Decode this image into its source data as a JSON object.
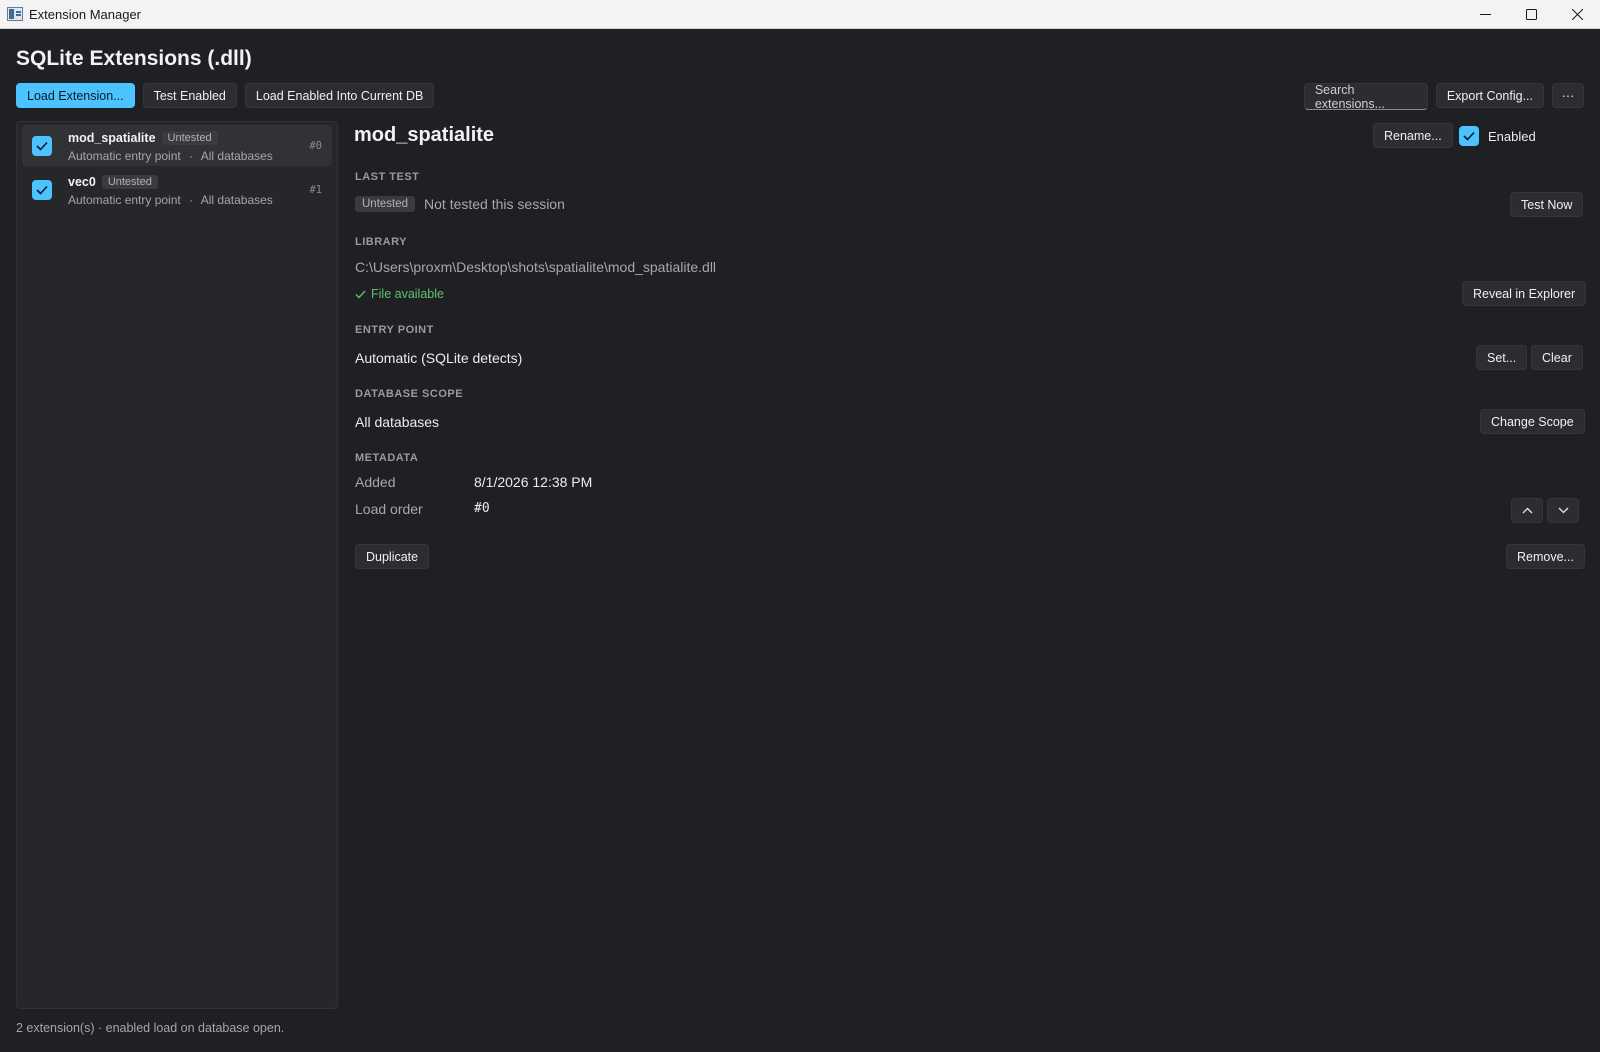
{
  "window": {
    "title": "Extension Manager",
    "controls": [
      "minimize-icon",
      "maximize-icon",
      "close-icon"
    ]
  },
  "header": {
    "title": "SQLite Extensions (.dll)",
    "toolbar": {
      "load_extension": "Load Extension...",
      "test_enabled": "Test Enabled",
      "load_enabled_into_db": "Load Enabled Into Current DB",
      "search_placeholder": "Search extensions...",
      "export_config": "Export Config...",
      "more": "···"
    }
  },
  "extensions": [
    {
      "name": "mod_spatialite",
      "status": "Untested",
      "entry": "Automatic entry point",
      "sep": "·",
      "scope": "All databases",
      "index": "#0",
      "enabled": true,
      "selected": true
    },
    {
      "name": "vec0",
      "status": "Untested",
      "entry": "Automatic entry point",
      "sep": "·",
      "scope": "All databases",
      "index": "#1",
      "enabled": true,
      "selected": false
    }
  ],
  "detail": {
    "title": "mod_spatialite",
    "rename": "Rename...",
    "enabled_label": "Enabled",
    "last_test": {
      "label": "LAST TEST",
      "badge": "Untested",
      "text": "Not tested this session",
      "button": "Test Now"
    },
    "library": {
      "label": "LIBRARY",
      "path": "C:\\Users\\proxm\\Desktop\\shots\\spatialite\\mod_spatialite.dll",
      "status": "File available",
      "button": "Reveal in Explorer"
    },
    "entry_point": {
      "label": "ENTRY POINT",
      "value": "Automatic (SQLite detects)",
      "set_button": "Set...",
      "clear_button": "Clear"
    },
    "database_scope": {
      "label": "DATABASE SCOPE",
      "value": "All databases",
      "button": "Change Scope"
    },
    "metadata": {
      "label": "METADATA",
      "added_key": "Added",
      "added_value": "8/1/2026 12:38 PM",
      "load_order_key": "Load order",
      "load_order_value": "#0"
    },
    "duplicate": "Duplicate",
    "remove": "Remove..."
  },
  "footer": {
    "status": "2 extension(s) · enabled load on database open."
  },
  "colors": {
    "accent": "#4cc2ff",
    "background": "#1f2023",
    "ok": "#5fc26b"
  }
}
